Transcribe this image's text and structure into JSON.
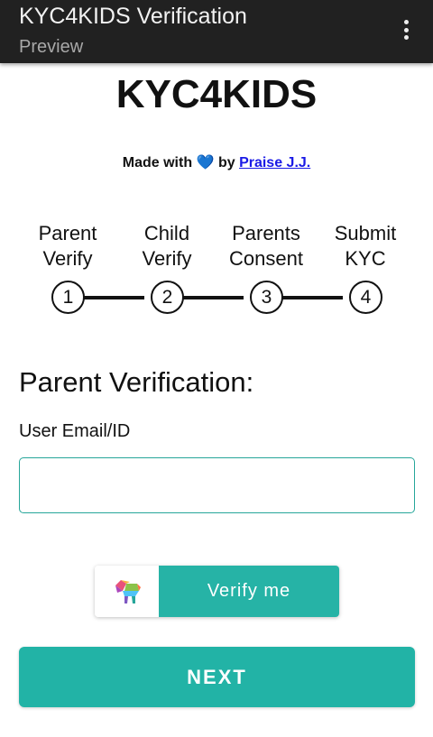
{
  "appbar": {
    "title": "KYC4KIDS Verification",
    "subtitle": "Preview",
    "menu_icon": "more-vertical-icon"
  },
  "header": {
    "brand": "KYC4KIDS",
    "credit_prefix": "Made with",
    "credit_heart": "💙",
    "credit_by": "by",
    "credit_link": "Praise J.J."
  },
  "steps": [
    {
      "label_line1": "Parent",
      "label_line2": "Verify",
      "number": "1"
    },
    {
      "label_line1": "Child",
      "label_line2": "Verify",
      "number": "2"
    },
    {
      "label_line1": "Parents",
      "label_line2": "Consent",
      "number": "3"
    },
    {
      "label_line1": "Submit",
      "label_line2": "KYC",
      "number": "4"
    }
  ],
  "form": {
    "section_title": "Parent Verification:",
    "email_label": "User Email/ID",
    "email_value": "",
    "email_placeholder": ""
  },
  "verify": {
    "logo_icon": "colorful-animal-logo-icon",
    "label": "Verify me"
  },
  "next_button": {
    "label": "NEXT"
  },
  "colors": {
    "appbar_bg": "#212121",
    "accent": "#22b3a6",
    "link": "#1a1ae6",
    "heart": "#1e6fd9"
  }
}
